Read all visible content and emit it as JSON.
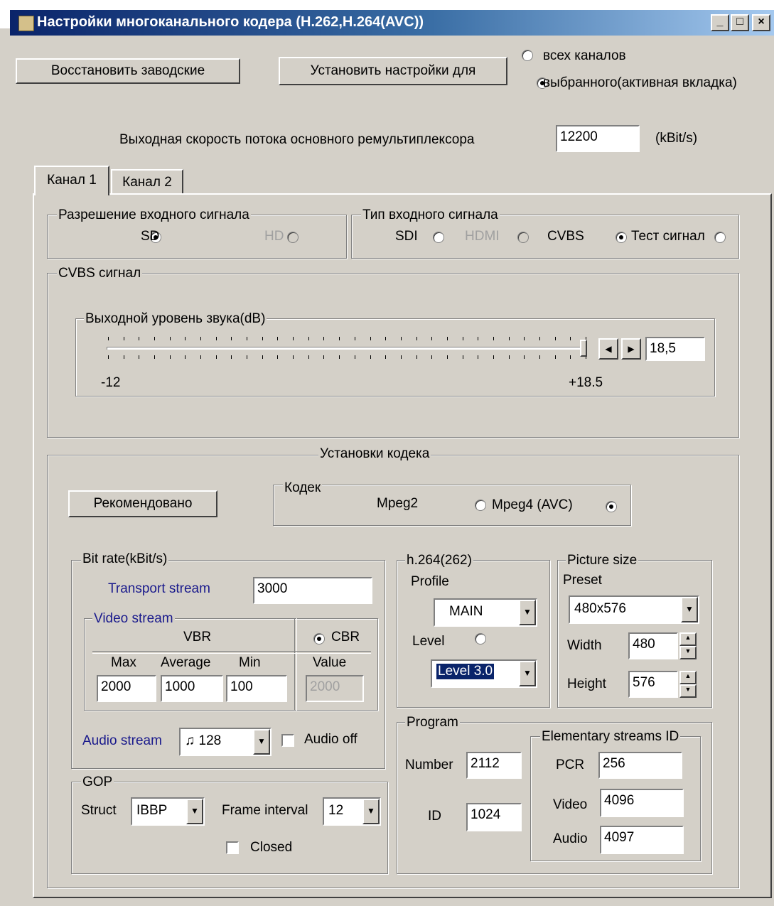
{
  "window": {
    "title": "Настройки многоканального  кодера (H.262,H.264(AVC))"
  },
  "top": {
    "restore_label": "Восстановить заводские",
    "apply_label": "Установить настройки для",
    "apply_scope": [
      {
        "label": "всех каналов",
        "selected": false
      },
      {
        "label": "выбранного(активная вкладка)",
        "selected": true
      }
    ],
    "mux_rate_label": "Выходная скорость потока  основного ремультиплексора",
    "mux_rate_value": "12200",
    "mux_rate_unit": "(kBit/s)"
  },
  "tabs": [
    {
      "label": "Канал 1",
      "active": true
    },
    {
      "label": "Канал 2",
      "active": false
    }
  ],
  "resolution": {
    "title": "Разрешение входного сигнала",
    "options": [
      {
        "label": "SD",
        "selected": true,
        "enabled": true
      },
      {
        "label": "HD",
        "selected": false,
        "enabled": false
      }
    ]
  },
  "signal_type": {
    "title": "Тип входного сигнала",
    "options": [
      {
        "label": "SDI",
        "selected": false,
        "enabled": true
      },
      {
        "label": "HDMI",
        "selected": false,
        "enabled": false
      },
      {
        "label": "CVBS",
        "selected": true,
        "enabled": true
      },
      {
        "label": "Тест сигнал",
        "selected": false,
        "enabled": true
      }
    ]
  },
  "cvbs": {
    "title": "CVBS сигнал",
    "audio_level_title": "Выходной уровень звука(dB)",
    "min_label": "-12",
    "max_label": "+18.5",
    "value": "18,5",
    "level_fraction": 1.0
  },
  "codec_settings": {
    "title": "Установки кодека",
    "recommended_label": "Рекомендовано",
    "codec_title": "Кодек",
    "codec_options": [
      {
        "label": "Mpeg2",
        "selected": false
      },
      {
        "label": "Mpeg4 (AVC)",
        "selected": true
      }
    ]
  },
  "bitrate": {
    "title": "Bit rate(kBit/s)",
    "transport_label": "Transport stream",
    "transport_value": "3000",
    "video_title": "Video stream",
    "vbr_label": "VBR",
    "cbr_label": "CBR",
    "max_label": "Max",
    "avg_label": "Average",
    "min_label": "Min",
    "value_label": "Value",
    "max_value": "2000",
    "avg_value": "1000",
    "min_value": "100",
    "cbr_value": "2000",
    "audio_label": "Audio stream",
    "audio_icon": "music-note-icon",
    "audio_value": "128",
    "audio_off_label": "Audio off"
  },
  "gop": {
    "title": "GOP",
    "struct_label": "Struct",
    "struct_value": "IBBP",
    "interval_label": "Frame interval",
    "interval_value": "12",
    "closed_label": "Closed"
  },
  "h264": {
    "title": "h.264(262)",
    "profile_label": "Profile",
    "profile_value": "MAIN",
    "level_label": "Level",
    "level_value": "Level 3.0"
  },
  "picture": {
    "title": "Picture size",
    "preset_label": "Preset",
    "preset_value": "480x576",
    "width_label": "Width",
    "width_value": "480",
    "height_label": "Height",
    "height_value": "576"
  },
  "program": {
    "title": "Program",
    "number_label": "Number",
    "number_value": "2112",
    "id_label": "ID",
    "id_value": "1024",
    "es_title": "Elementary streams ID",
    "pcr_label": "PCR",
    "pcr_value": "256",
    "video_label": "Video",
    "video_value": "4096",
    "audio_label": "Audio",
    "audio_value": "4097"
  }
}
